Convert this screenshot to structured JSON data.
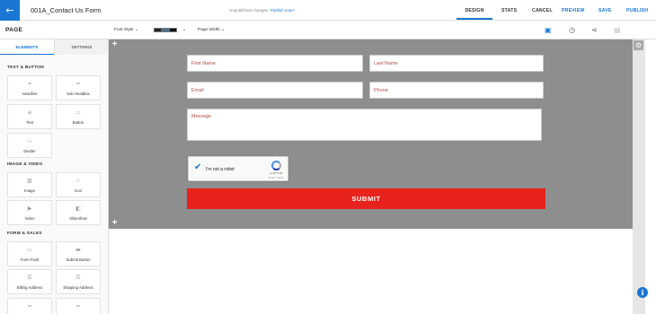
{
  "header": {
    "page_name": "001A_Contact Us Form",
    "unsaved_text": "Unpublished changes.",
    "publish_now_link": "Publish now?",
    "actions": {
      "design": "DESIGN",
      "stats": "STATS",
      "cancel": "CANCEL",
      "preview": "PREVIEW",
      "save": "SAVE",
      "publish": "PUBLISH"
    },
    "accent_color": "#1976d2"
  },
  "toolbar": {
    "title": "PAGE",
    "font_style_label": "Font Style",
    "page_width_label": "Page Width"
  },
  "sidebar": {
    "tabs": {
      "elements": "ELEMENTS",
      "settings": "SETTINGS"
    },
    "sections": {
      "text_button": "TEXT & BUTTON",
      "image_video": "IMAGE & VIDEO",
      "form_sales": "FORM & SALES"
    },
    "elements": {
      "headline": {
        "label": "Headline",
        "icon": "text-lines-icon"
      },
      "sub_headline": {
        "label": "Sub Headline",
        "icon": "text-lines-icon"
      },
      "text": {
        "label": "Text",
        "icon": "paragraph-icon"
      },
      "button": {
        "label": "Button",
        "icon": "button-icon"
      },
      "divider": {
        "label": "Divider",
        "icon": "divider-icon"
      },
      "image": {
        "label": "Image",
        "icon": "image-icon"
      },
      "icon": {
        "label": "Icon",
        "icon": "star-icon"
      },
      "video": {
        "label": "Video",
        "icon": "video-icon"
      },
      "slideshow": {
        "label": "Slideshow",
        "icon": "slideshow-icon"
      },
      "form_field": {
        "label": "Form Field",
        "icon": "form-field-icon"
      },
      "submit_button": {
        "label": "Submit Button",
        "icon": "submit-button-icon"
      },
      "billing_address": {
        "label": "Billing Address",
        "icon": "address-icon"
      },
      "shipping_address": {
        "label": "Shipping Address",
        "icon": "address-icon"
      }
    }
  },
  "form": {
    "first_name_placeholder": "First Name",
    "last_name_placeholder": "Last Name",
    "email_placeholder": "Email",
    "phone_placeholder": "Phone",
    "message_placeholder": "Message",
    "recaptcha_label": "I'm not a robot",
    "recaptcha_brand": "reCAPTCHA",
    "recaptcha_links": "Privacy - Terms",
    "submit_label": "SUBMIT",
    "submit_color": "#e8231d",
    "section_background": "#8e8e8e"
  }
}
